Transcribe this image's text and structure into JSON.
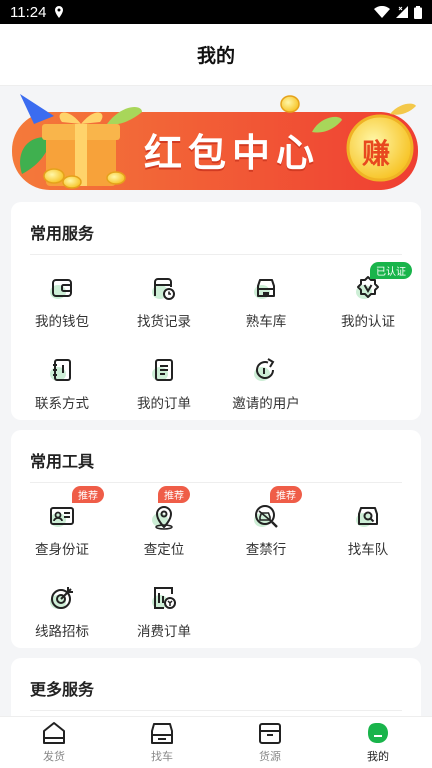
{
  "status_bar": {
    "time": "11:24"
  },
  "header": {
    "title": "我的"
  },
  "banner": {
    "text": "红包中心",
    "badge": "赚"
  },
  "sections": {
    "common_services": {
      "title": "常用服务",
      "items": [
        {
          "label": "我的钱包"
        },
        {
          "label": "找货记录"
        },
        {
          "label": "熟车库"
        },
        {
          "label": "我的认证",
          "badge": "已认证"
        },
        {
          "label": "联系方式"
        },
        {
          "label": "我的订单"
        },
        {
          "label": "邀请的用户"
        }
      ]
    },
    "common_tools": {
      "title": "常用工具",
      "items": [
        {
          "label": "查身份证",
          "badge": "推荐"
        },
        {
          "label": "查定位",
          "badge": "推荐"
        },
        {
          "label": "查禁行",
          "badge": "推荐"
        },
        {
          "label": "找车队"
        },
        {
          "label": "线路招标"
        },
        {
          "label": "消费订单"
        }
      ]
    },
    "more_services": {
      "title": "更多服务"
    }
  },
  "tabbar": {
    "tabs": [
      {
        "label": "发货"
      },
      {
        "label": "找车"
      },
      {
        "label": "货源"
      },
      {
        "label": "我的"
      }
    ],
    "active_index": 3
  },
  "colors": {
    "accent_green": "#19b44b",
    "badge_red": "#ef5d48",
    "banner_red": "#ef4a36"
  }
}
